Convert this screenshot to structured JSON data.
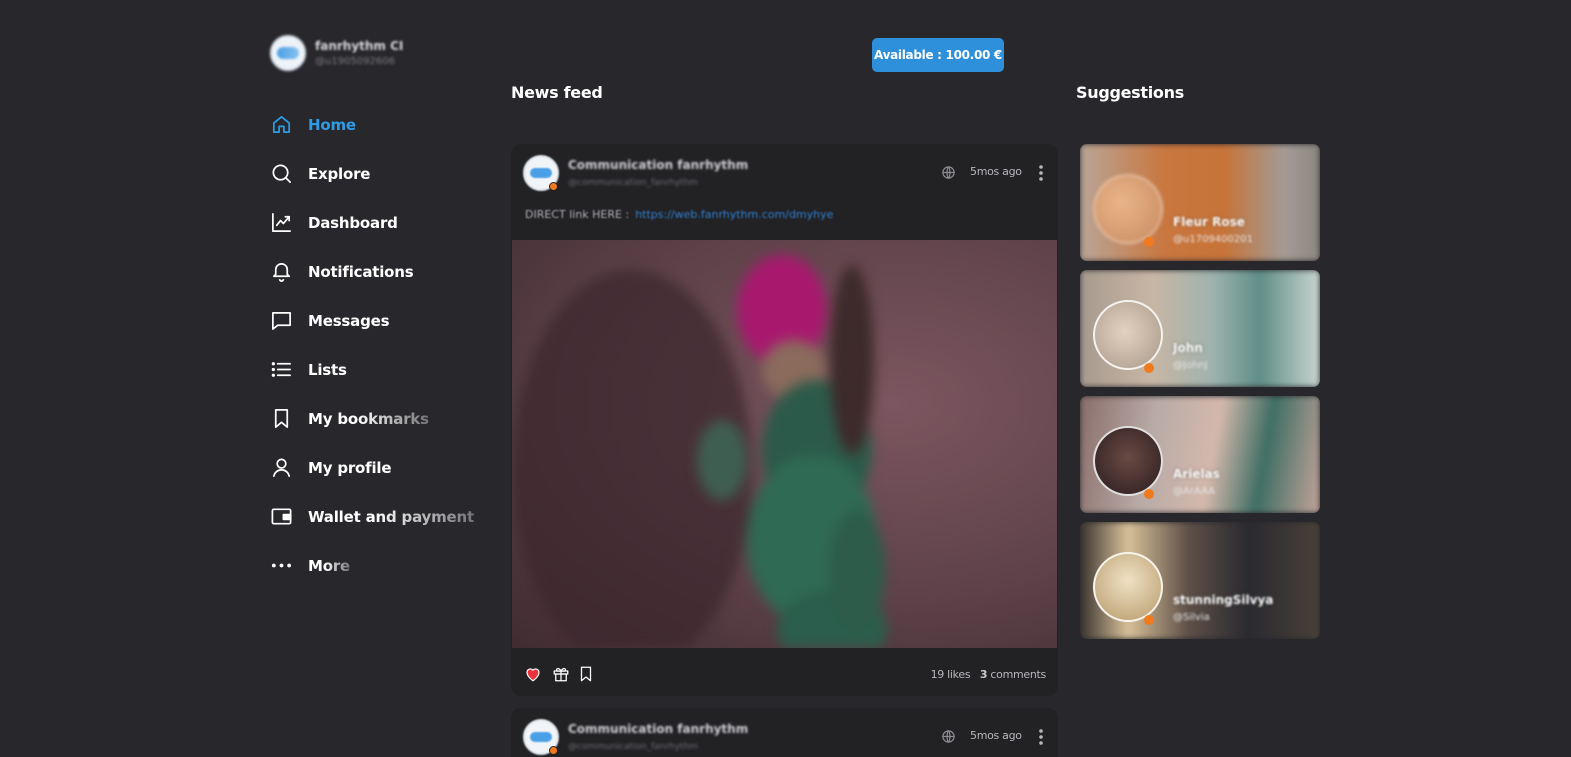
{
  "profile": {
    "name": "fanrhythm CI",
    "handle": "@u1905092606"
  },
  "nav": {
    "items": [
      {
        "label": "Home",
        "icon": "home-icon"
      },
      {
        "label": "Explore",
        "icon": "search-icon"
      },
      {
        "label": "Dashboard",
        "icon": "chart-icon"
      },
      {
        "label": "Notifications",
        "icon": "bell-icon"
      },
      {
        "label": "Messages",
        "icon": "message-icon"
      },
      {
        "label": "Lists",
        "icon": "list-icon"
      },
      {
        "label": "My bookmarks",
        "icon": "bookmark-icon"
      },
      {
        "label": "My profile",
        "icon": "user-icon"
      },
      {
        "label": "Wallet and payment",
        "icon": "wallet-icon"
      },
      {
        "label": "More",
        "icon": "more-dots-icon"
      }
    ]
  },
  "balance": {
    "label": "Available : 100.00 €"
  },
  "feed": {
    "title": "News feed",
    "posts": [
      {
        "author": "Communication fanrhythm",
        "handle": "@communication_fanrhythm",
        "time": "5mos ago",
        "text": "DIRECT link HERE :",
        "link": "https://web.fanrhythm.com/dmyhye",
        "likes": "19 likes",
        "comments_count": "3",
        "comments_label": " comments"
      },
      {
        "author": "Communication fanrhythm",
        "handle": "@communication_fanrhythm",
        "time": "5mos ago"
      }
    ]
  },
  "suggestions": {
    "title": "Suggestions",
    "items": [
      {
        "name": "Fleur Rose",
        "handle": "@u1709400201"
      },
      {
        "name": "John",
        "handle": "@JohnJ"
      },
      {
        "name": "Arielas",
        "handle": "@ArAAA"
      },
      {
        "name": "stunningSilvya",
        "handle": "@Silvia"
      }
    ]
  },
  "colors": {
    "background": "#28282c",
    "accent": "#2e9be6",
    "button": "#2e8fdb",
    "card": "#222225",
    "online": "#f07a1d",
    "like": "#e8333d"
  }
}
